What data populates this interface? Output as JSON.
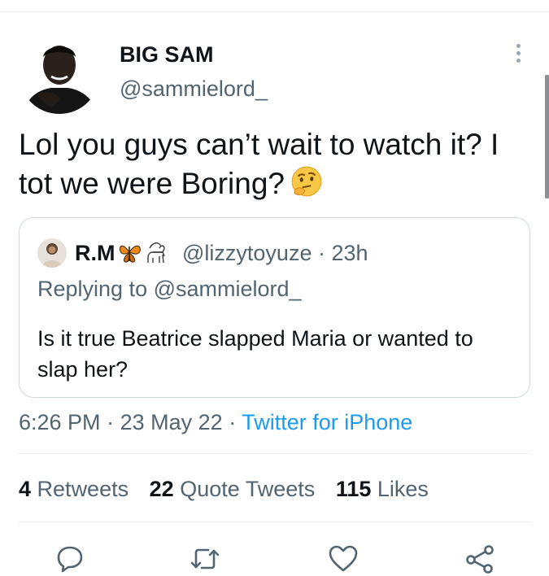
{
  "author": {
    "display_name": "BIG SAM",
    "handle": "@sammielord_"
  },
  "tweet": {
    "text": "Lol you guys can’t wait to watch it? I tot we were Boring?",
    "emoji": "thinking-face"
  },
  "quoted_tweet": {
    "name": "R.M",
    "name_emojis": [
      "butterfly",
      "goat"
    ],
    "handle": "@lizzytoyuze",
    "age": "23h",
    "replying_label": "Replying to",
    "replying_handle": "@sammielord_",
    "text": "Is it true Beatrice slapped Maria or wanted to slap her?"
  },
  "meta": {
    "time": "6:26 PM",
    "date": "23 May 22",
    "source": "Twitter for iPhone",
    "separator": "·"
  },
  "stats": {
    "retweets_count": "4",
    "retweets_label": "Retweets",
    "quotes_count": "22",
    "quotes_label": "Quote Tweets",
    "likes_count": "115",
    "likes_label": "Likes"
  },
  "actions": [
    "reply-icon",
    "retweet-icon",
    "like-icon",
    "share-icon"
  ],
  "colors": {
    "link": "#1d9bf0",
    "secondary_text": "#536471",
    "primary_text": "#0f1419",
    "border": "#cfd9de"
  }
}
